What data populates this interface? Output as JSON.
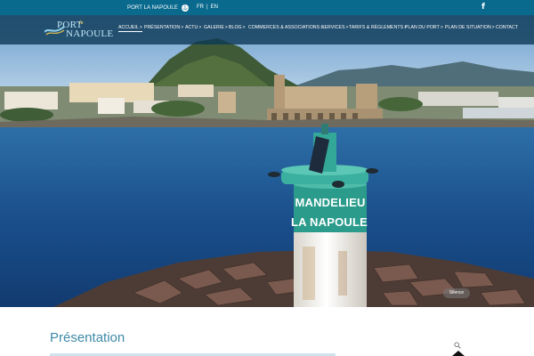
{
  "topbar": {
    "site_name": "PORT LA NAPOULE",
    "anchor_symbol": "⚓",
    "lang_fr": "FR",
    "lang_sep": "|",
    "lang_en": "EN",
    "facebook_symbol": "f"
  },
  "logo": {
    "word1": "PORT",
    "word2": "la",
    "word3": "NAPOULE"
  },
  "nav": {
    "items": [
      {
        "label": "ACCUEIL",
        "chev": ">"
      },
      {
        "label": "PRÉSENTATION",
        "chev": ">"
      },
      {
        "label": "ACTU",
        "chev": ">"
      },
      {
        "label": "GALERIE",
        "chev": ">"
      },
      {
        "label": "BLOG",
        "chev": ">"
      },
      {
        "label": "COMMERCES & ASSOCIATIONS",
        "chev": ">"
      },
      {
        "label": "SERVICES",
        "chev": ">"
      },
      {
        "label": "TARIFS & RÈGLEMENTS",
        "chev": ">"
      },
      {
        "label": "PLAN DU PORT",
        "chev": ">"
      },
      {
        "label": "PLAN DE SITUATION",
        "chev": ">"
      },
      {
        "label": "CONTACT",
        "chev": ""
      }
    ],
    "active_index": 0
  },
  "hero": {
    "lighthouse_line1": "MANDELIEU",
    "lighthouse_line2": "LA NAPOULE",
    "silence_button": "Silence"
  },
  "section": {
    "title": "Présentation"
  },
  "colors": {
    "topbar": "#0a6a8e",
    "accent": "#3e8aa8",
    "lighthouse_band": "#1f9a87"
  }
}
